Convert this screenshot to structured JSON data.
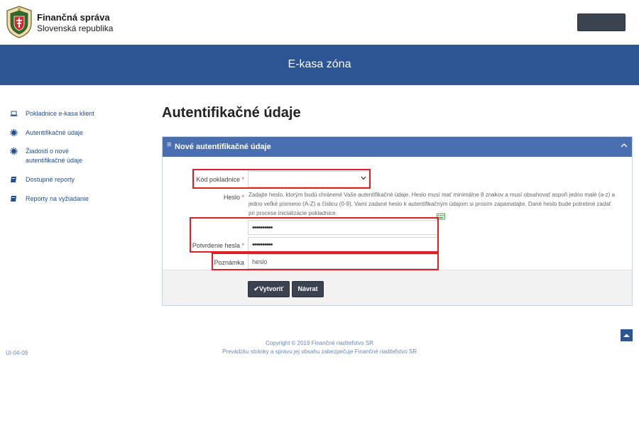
{
  "header": {
    "org_name": "Finančná správa",
    "org_country": "Slovenská republika",
    "banner_title": "E-kasa zóna"
  },
  "sidebar": {
    "items": [
      {
        "label": "Pokladnice e-kasa klient",
        "icon": "laptop-icon"
      },
      {
        "label": "Autentifikačné údaje",
        "icon": "gear-icon"
      },
      {
        "label": "Žiadosti o nové autentifikačné údaje",
        "icon": "gear-icon"
      },
      {
        "label": "Dostupné reporty",
        "icon": "book-icon"
      },
      {
        "label": "Reporty na vyžiadanie",
        "icon": "book-icon"
      }
    ]
  },
  "main": {
    "title": "Autentifikačné údaje",
    "panel_title": "Nové autentifikačné údaje"
  },
  "form": {
    "cash_register_label": "Kód pokladnice",
    "cash_register_value": "",
    "password_label": "Heslo",
    "password_help": "Zadajte heslo, ktorým budú chránené Vaše autentifikačné údaje. Heslo musí mať minimálne 8 znakov a musí obsahovať aspoň jedno malé (a-z) a jedno veľké písmeno (A-Z) a číslicu (0-9). Vami zadané heslo k autentifikačným údajom si prosím zapamatajte. Dané heslo bude potrebné zadať pri procese inicializácie pokladnice.",
    "password_value": "••••••••••",
    "confirm_label": "Potvrdenie hesla",
    "confirm_value": "••••••••••",
    "note_label": "Poznámka",
    "note_value": "heslo",
    "required_mark": "*"
  },
  "buttons": {
    "create": "✔Vytvoriť",
    "back": "Návrat"
  },
  "footer": {
    "copyright": "Copyright © 2019 Finančné riaditeľstvo SR",
    "operator": "Prevádzku stránky a správu jej obsahu zabezpečuje Finančné riaditeľstvo SR",
    "version": "UI-04-09"
  },
  "colors": {
    "banner": "#2d5594",
    "panel_header": "#4a6fb0",
    "highlight": "#e01e26",
    "link": "#1f4f91"
  }
}
